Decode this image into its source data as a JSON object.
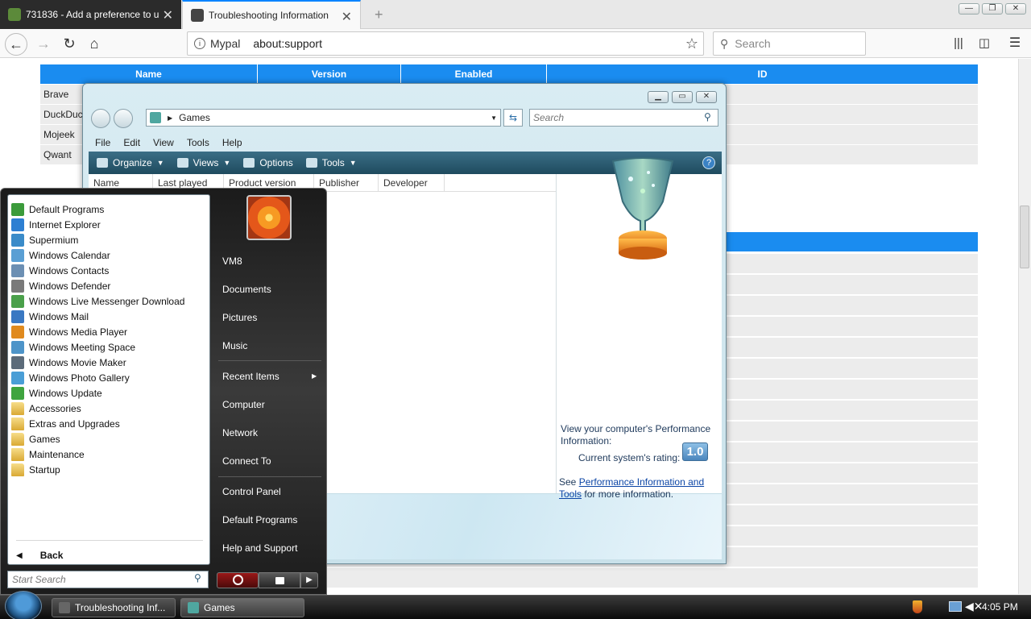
{
  "browser": {
    "tabs": [
      {
        "title": "731836 - Add a preference to u",
        "active": false
      },
      {
        "title": "Troubleshooting Information",
        "active": true
      }
    ],
    "new_tab_label": "+",
    "url_identity": "Mypal",
    "url": "about:support",
    "search_placeholder": "Search",
    "window_controls": [
      "—",
      "❐",
      "✕"
    ]
  },
  "support_table": {
    "headers": [
      "Name",
      "Version",
      "Enabled",
      "ID"
    ],
    "rows": [
      "Brave",
      "DuckDuc",
      "Mojeek",
      "Qwant"
    ]
  },
  "games_window": {
    "breadcrumb": "Games",
    "search_placeholder": "Search",
    "menu": [
      "File",
      "Edit",
      "View",
      "Tools",
      "Help"
    ],
    "toolbar": [
      "Organize",
      "Views",
      "Options",
      "Tools"
    ],
    "columns": [
      "Name",
      "Last played",
      "Product version",
      "Publisher",
      "Developer"
    ],
    "perf_text": "View your computer's Performance Information:",
    "rating_label": "Current system's rating:",
    "rating_value": "1.0",
    "see_prefix": "See",
    "see_link": "Performance Information and Tools",
    "see_suffix": "for more information."
  },
  "start_menu": {
    "programs": [
      {
        "label": "Default Programs",
        "icon": "default-programs-icon",
        "color": "#3b9b3b"
      },
      {
        "label": "Internet Explorer",
        "icon": "internet-explorer-icon",
        "color": "#2d7fd2"
      },
      {
        "label": "Supermium",
        "icon": "supermium-icon",
        "color": "#3a8bc9"
      },
      {
        "label": "Windows Calendar",
        "icon": "calendar-icon",
        "color": "#5a9fd4"
      },
      {
        "label": "Windows Contacts",
        "icon": "contacts-icon",
        "color": "#6c8fb3"
      },
      {
        "label": "Windows Defender",
        "icon": "defender-icon",
        "color": "#7a7a7a"
      },
      {
        "label": "Windows Live Messenger Download",
        "icon": "messenger-icon",
        "color": "#4aa04a"
      },
      {
        "label": "Windows Mail",
        "icon": "mail-icon",
        "color": "#3a78c2"
      },
      {
        "label": "Windows Media Player",
        "icon": "media-player-icon",
        "color": "#e08a1e"
      },
      {
        "label": "Windows Meeting Space",
        "icon": "meeting-space-icon",
        "color": "#4d94c9"
      },
      {
        "label": "Windows Movie Maker",
        "icon": "movie-maker-icon",
        "color": "#5c6b7a"
      },
      {
        "label": "Windows Photo Gallery",
        "icon": "photo-gallery-icon",
        "color": "#4a9ed6"
      },
      {
        "label": "Windows Update",
        "icon": "update-icon",
        "color": "#3fa43f"
      },
      {
        "label": "Accessories",
        "icon": "folder-icon",
        "color": "#e3b94a"
      },
      {
        "label": "Extras and Upgrades",
        "icon": "folder-icon",
        "color": "#e3b94a"
      },
      {
        "label": "Games",
        "icon": "folder-icon",
        "color": "#e3b94a"
      },
      {
        "label": "Maintenance",
        "icon": "folder-icon",
        "color": "#e3b94a"
      },
      {
        "label": "Startup",
        "icon": "folder-icon",
        "color": "#e3b94a"
      }
    ],
    "back_label": "Back",
    "search_placeholder": "Start Search",
    "user": "VM8",
    "right_links": [
      "Documents",
      "Pictures",
      "Music",
      "Recent Items",
      "Computer",
      "Network",
      "Connect To",
      "Control Panel",
      "Default Programs",
      "Help and Support"
    ]
  },
  "taskbar": {
    "buttons": [
      "Troubleshooting Inf...",
      "Games"
    ],
    "time": "4:05 PM"
  }
}
